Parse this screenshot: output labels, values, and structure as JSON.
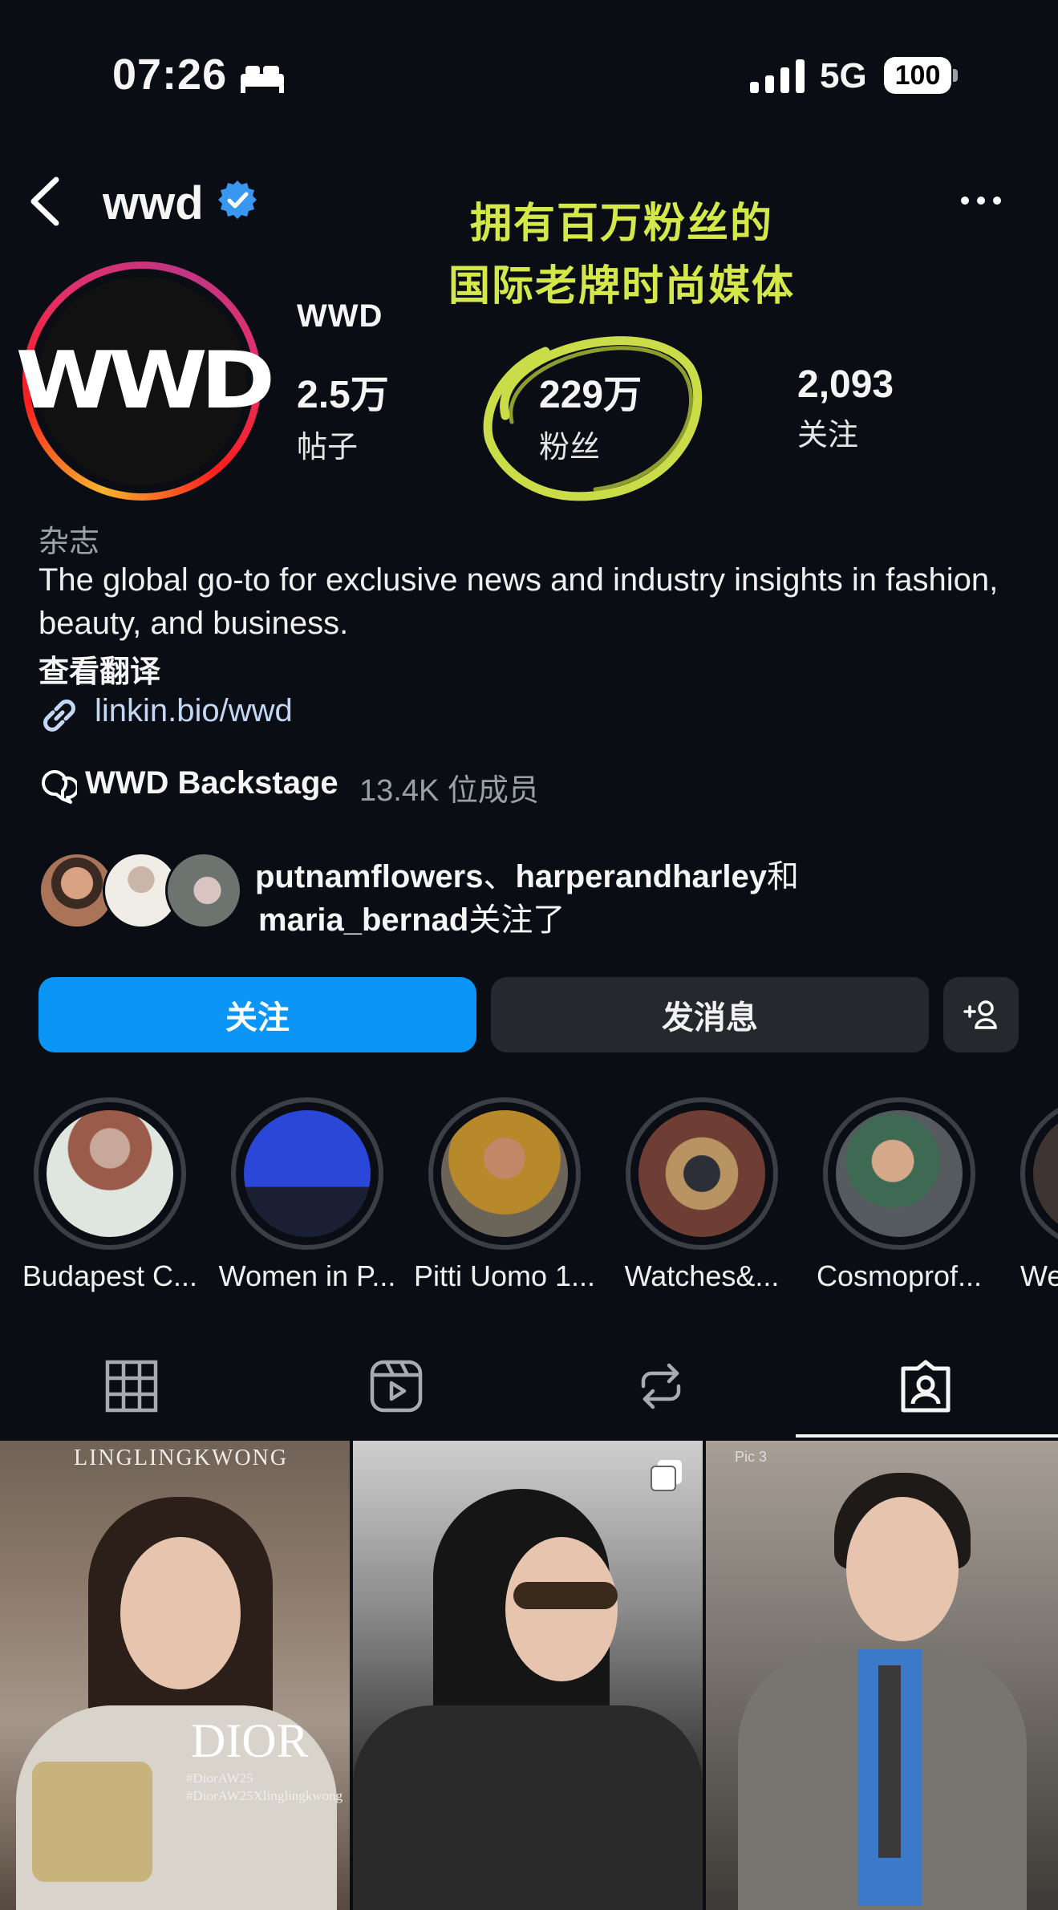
{
  "status_bar": {
    "time": "07:26",
    "network": "5G",
    "battery": "100"
  },
  "header": {
    "handle": "wwd"
  },
  "annotation": {
    "line1": "拥有百万粉丝的",
    "line2": "国际老牌时尚媒体",
    "color": "#d5e84a"
  },
  "profile": {
    "avatar_text": "WWD",
    "display_name": "WWD",
    "stats": [
      {
        "value": "2.5万",
        "label": "帖子"
      },
      {
        "value": "229万",
        "label": "粉丝"
      },
      {
        "value": "2,093",
        "label": "关注"
      }
    ],
    "category": "杂志",
    "bio": "The global go-to for exclusive news and industry insights in fashion, beauty, and business.",
    "translate_label": "查看翻译",
    "link": "linkin.bio/wwd",
    "channel_name": "WWD Backstage",
    "channel_members": "13.4K 位成员"
  },
  "mutual": {
    "user1": "putnamflowers",
    "separator": "、",
    "user2": "harperandharley",
    "and": "和",
    "user3": "maria_bernad",
    "suffix": "关注了"
  },
  "buttons": {
    "follow": "关注",
    "message": "发消息"
  },
  "highlights": [
    {
      "label": "Budapest C..."
    },
    {
      "label": "Women in P..."
    },
    {
      "label": "Pitti Uomo 1..."
    },
    {
      "label": "Watches&..."
    },
    {
      "label": "Cosmoprof..."
    },
    {
      "label": "Wee"
    }
  ],
  "posts": [
    {
      "overlay_top": "LINGLINGKWONG",
      "overlay_brand": "DIOR",
      "overlay_tag1": "#DiorAW25",
      "overlay_tag2": "#DiorAW25Xlinglingkwong"
    },
    {},
    {
      "watermark": "Pic 3"
    }
  ],
  "colors": {
    "background": "#0b0d14",
    "follow_button": "#0a95f7",
    "secondary_button": "#26282e",
    "verified": "#3897f0",
    "link": "#c2d8f5"
  }
}
